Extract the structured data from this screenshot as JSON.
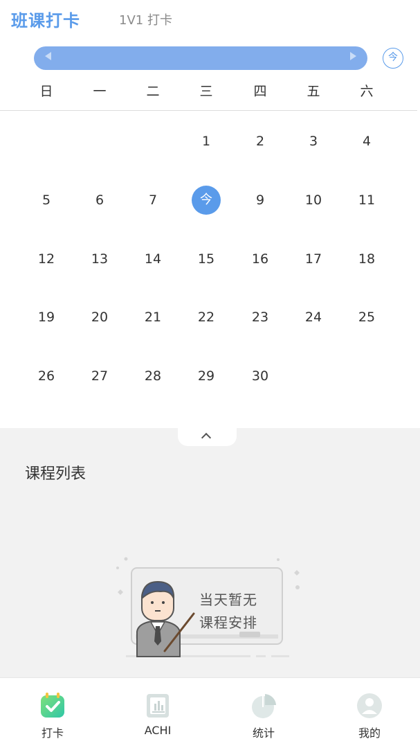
{
  "tabs": {
    "active": "班课打卡",
    "other": "1V1 打卡"
  },
  "calendar": {
    "month_label": "",
    "today_button": "今",
    "weekdays": [
      "日",
      "一",
      "二",
      "三",
      "四",
      "五",
      "六"
    ],
    "days": [
      "1",
      "2",
      "3",
      "4",
      "5",
      "6",
      "7",
      "今",
      "9",
      "10",
      "11",
      "12",
      "13",
      "14",
      "15",
      "16",
      "17",
      "18",
      "19",
      "20",
      "21",
      "22",
      "23",
      "24",
      "25",
      "26",
      "27",
      "28",
      "29",
      "30"
    ],
    "first_weekday_index": 3,
    "today_index": 7,
    "accent_color": "#5a9bea",
    "bar_color": "#82adec"
  },
  "course_list": {
    "title": "课程列表",
    "empty_line1": "当天暂无",
    "empty_line2": "课程安排"
  },
  "nav": {
    "items": [
      {
        "label": "打卡",
        "icon": "checkin-icon"
      },
      {
        "label": "ACHI",
        "icon": "chart-board-icon"
      },
      {
        "label": "统计",
        "icon": "pie-chart-icon"
      },
      {
        "label": "我的",
        "icon": "profile-icon"
      }
    ]
  }
}
